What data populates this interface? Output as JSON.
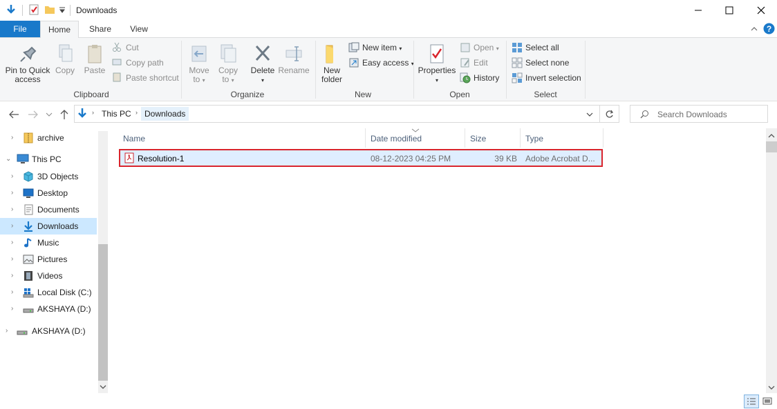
{
  "window": {
    "title": "Downloads"
  },
  "ribbon_tabs": [
    "File",
    "Home",
    "Share",
    "View"
  ],
  "ribbon": {
    "clipboard": {
      "label": "Clipboard",
      "pin_line1": "Pin to Quick",
      "pin_line2": "access",
      "copy": "Copy",
      "paste": "Paste",
      "cut": "Cut",
      "copy_path": "Copy path",
      "paste_shortcut": "Paste shortcut"
    },
    "organize": {
      "label": "Organize",
      "move_line1": "Move",
      "move_line2": "to",
      "copy_line1": "Copy",
      "copy_line2": "to",
      "delete": "Delete",
      "rename": "Rename"
    },
    "new": {
      "label": "New",
      "folder_line1": "New",
      "folder_line2": "folder",
      "new_item": "New item",
      "easy_access": "Easy access"
    },
    "open": {
      "label": "Open",
      "properties": "Properties",
      "open": "Open",
      "edit": "Edit",
      "history": "History"
    },
    "select": {
      "label": "Select",
      "select_all": "Select all",
      "select_none": "Select none",
      "invert_selection": "Invert selection"
    }
  },
  "address": {
    "crumbs": [
      "This PC",
      "Downloads"
    ],
    "search_placeholder": "Search Downloads"
  },
  "nav": {
    "items": [
      {
        "label": "archive"
      },
      {
        "label": "This PC"
      },
      {
        "label": "3D Objects"
      },
      {
        "label": "Desktop"
      },
      {
        "label": "Documents"
      },
      {
        "label": "Downloads"
      },
      {
        "label": "Music"
      },
      {
        "label": "Pictures"
      },
      {
        "label": "Videos"
      },
      {
        "label": "Local Disk (C:)"
      },
      {
        "label": "AKSHAYA (D:)"
      },
      {
        "label": "AKSHAYA (D:)"
      }
    ]
  },
  "columns": {
    "name": "Name",
    "date": "Date modified",
    "size": "Size",
    "type": "Type"
  },
  "files": [
    {
      "name": "Resolution-1",
      "date": "08-12-2023 04:25 PM",
      "size": "39 KB",
      "type": "Adobe Acrobat D..."
    }
  ],
  "colors": {
    "accent": "#1979ca",
    "selection": "#cce8ff",
    "highlight_border": "#d9242c"
  }
}
